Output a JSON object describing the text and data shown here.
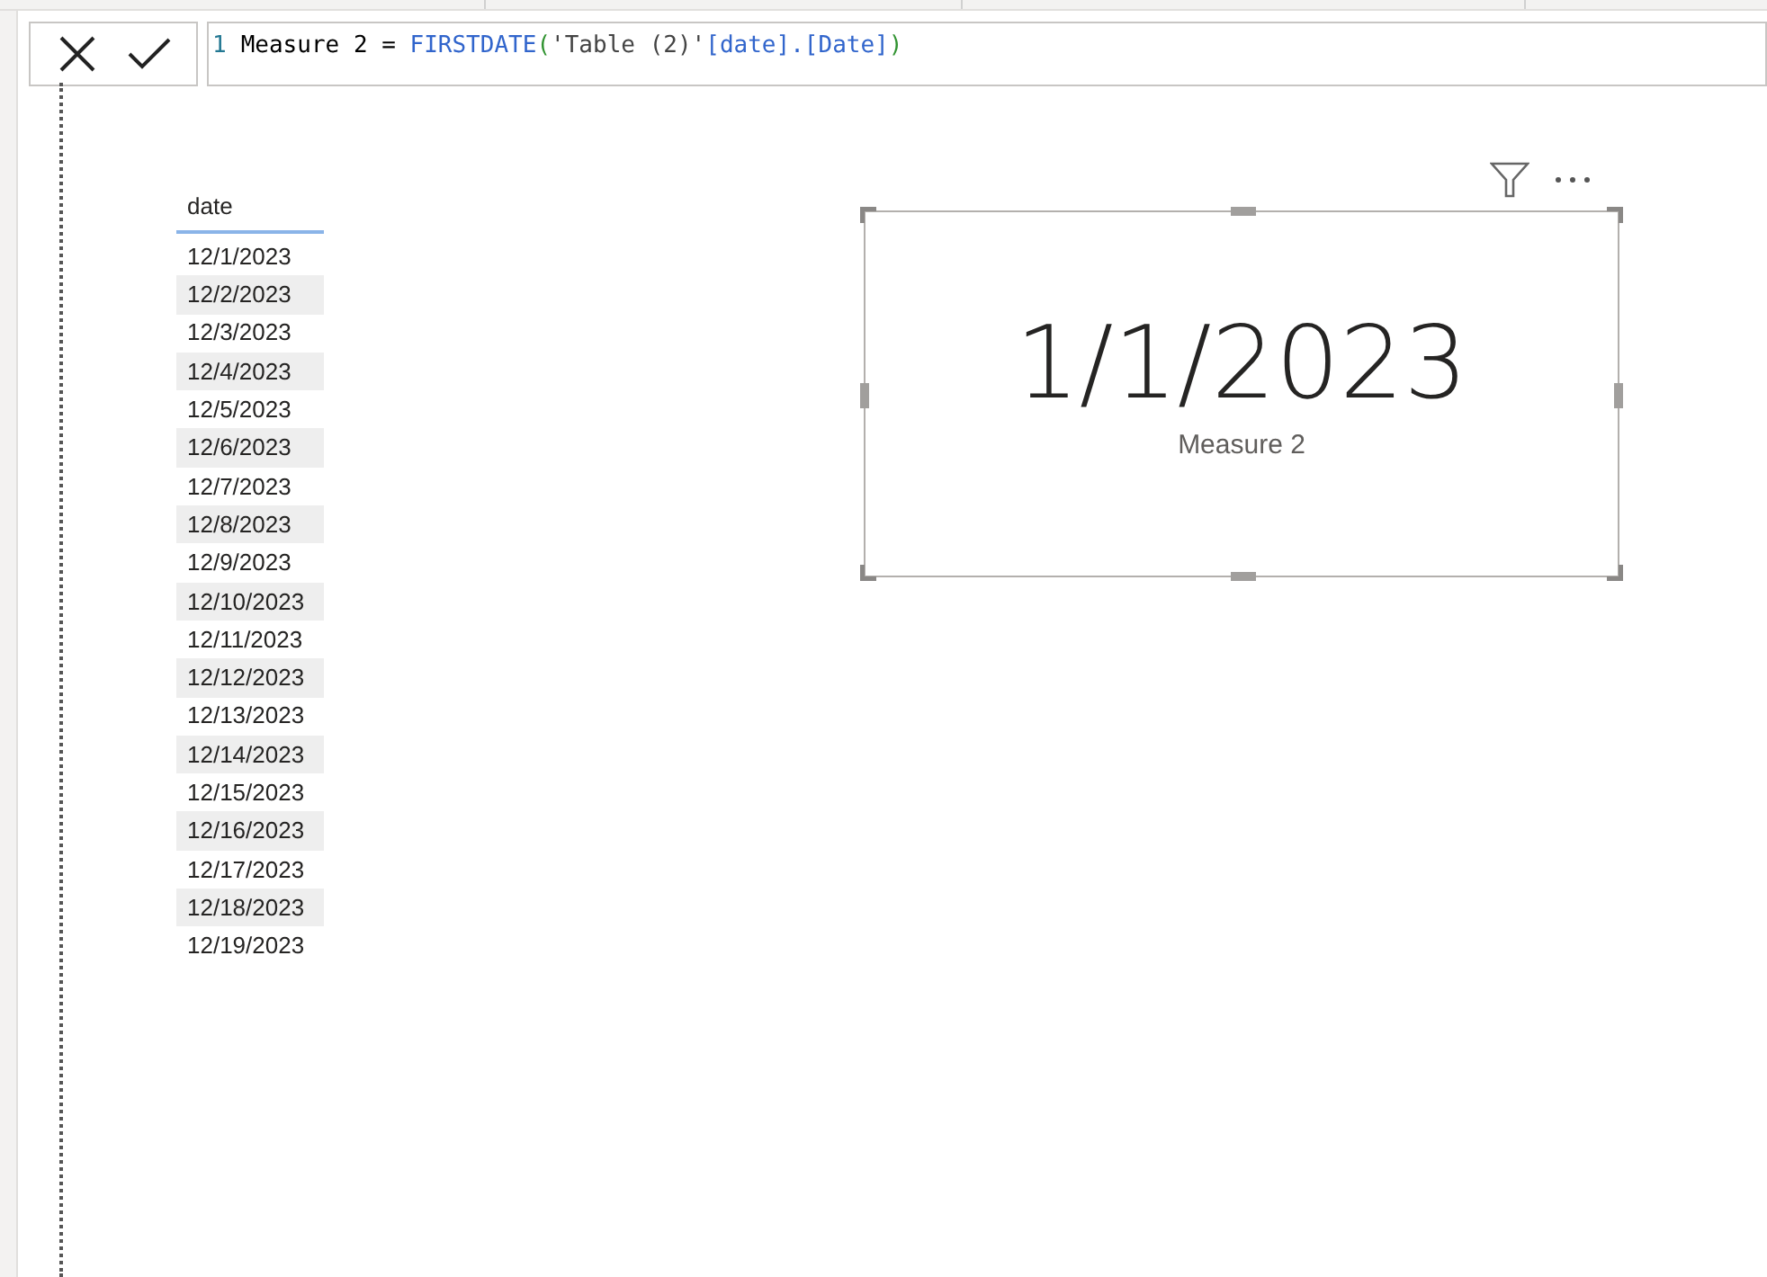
{
  "formula_bar": {
    "line_number": "1",
    "tokens": [
      {
        "kind": "plain",
        "text": "Measure 2 = "
      },
      {
        "kind": "function",
        "text": "FIRSTDATE"
      },
      {
        "kind": "paren",
        "text": "("
      },
      {
        "kind": "table",
        "text": "'Table (2)'"
      },
      {
        "kind": "column",
        "text": "[date].[Date]"
      },
      {
        "kind": "paren",
        "text": ")"
      }
    ]
  },
  "table": {
    "columns": [
      "date"
    ],
    "rows": [
      [
        "12/1/2023"
      ],
      [
        "12/2/2023"
      ],
      [
        "12/3/2023"
      ],
      [
        "12/4/2023"
      ],
      [
        "12/5/2023"
      ],
      [
        "12/6/2023"
      ],
      [
        "12/7/2023"
      ],
      [
        "12/8/2023"
      ],
      [
        "12/9/2023"
      ],
      [
        "12/10/2023"
      ],
      [
        "12/11/2023"
      ],
      [
        "12/12/2023"
      ],
      [
        "12/13/2023"
      ],
      [
        "12/14/2023"
      ],
      [
        "12/15/2023"
      ],
      [
        "12/16/2023"
      ],
      [
        "12/17/2023"
      ],
      [
        "12/18/2023"
      ],
      [
        "12/19/2023"
      ]
    ]
  },
  "card": {
    "value": "1/1/2023",
    "label": "Measure 2",
    "selected": true
  }
}
